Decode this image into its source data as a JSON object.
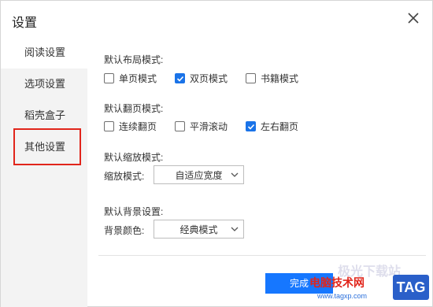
{
  "dialog": {
    "title": "设置"
  },
  "sidebar": {
    "items": [
      {
        "label": "阅读设置"
      },
      {
        "label": "选项设置"
      },
      {
        "label": "稻壳盒子"
      },
      {
        "label": "其他设置"
      }
    ]
  },
  "layout_mode": {
    "title": "默认布局模式:",
    "options": [
      {
        "label": "单页模式",
        "checked": false
      },
      {
        "label": "双页模式",
        "checked": true
      },
      {
        "label": "书籍模式",
        "checked": false
      }
    ]
  },
  "page_turn_mode": {
    "title": "默认翻页模式:",
    "options": [
      {
        "label": "连续翻页",
        "checked": false
      },
      {
        "label": "平滑滚动",
        "checked": false
      },
      {
        "label": "左右翻页",
        "checked": true
      }
    ]
  },
  "zoom_mode": {
    "title": "默认缩放模式:",
    "label": "缩放模式:",
    "value": "自适应宽度"
  },
  "background": {
    "title": "默认背景设置:",
    "label": "背景颜色:",
    "value": "经典模式"
  },
  "footer": {
    "done_label": "完成"
  },
  "watermark": {
    "brand": "电脑技术网",
    "url": "www.tagxp.com",
    "tag": "TAG",
    "faint": "极光下载站"
  },
  "colors": {
    "accent": "#1677ff",
    "highlight": "#e1251b"
  }
}
